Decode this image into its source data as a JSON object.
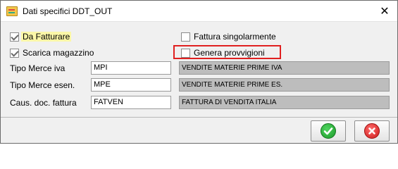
{
  "window": {
    "title": "Dati specifici DDT_OUT",
    "app_icon": "document-icon",
    "close_glyph": "✕"
  },
  "checkboxes": {
    "da_fatturare": {
      "label": "Da Fatturare",
      "checked": true
    },
    "scarica_magazzino": {
      "label": "Scarica magazzino",
      "checked": true
    },
    "fattura_singolarmente": {
      "label": "Fattura singolarmente",
      "checked": false
    },
    "genera_provvigioni": {
      "label": "Genera provvigioni",
      "checked": false
    }
  },
  "fields": [
    {
      "label": "Tipo Merce iva",
      "value": "MPI",
      "description": "VENDITE MATERIE PRIME IVA"
    },
    {
      "label": "Tipo Merce esen.",
      "value": "MPE",
      "description": "VENDITE MATERIE PRIME ES."
    },
    {
      "label": "Caus. doc. fattura",
      "value": "FATVEN",
      "description": "FATTURA DI VENDITA ITALIA"
    }
  ],
  "buttons": {
    "confirm": {
      "icon": "check-icon",
      "glyph": "✔"
    },
    "cancel": {
      "icon": "cancel-icon",
      "glyph": "✖"
    }
  },
  "colors": {
    "highlight_frame": "#e02020",
    "highlight_label_bg": "#fbf7a8",
    "confirm_green": "#1c9a2a",
    "cancel_red": "#cc1a1a"
  }
}
